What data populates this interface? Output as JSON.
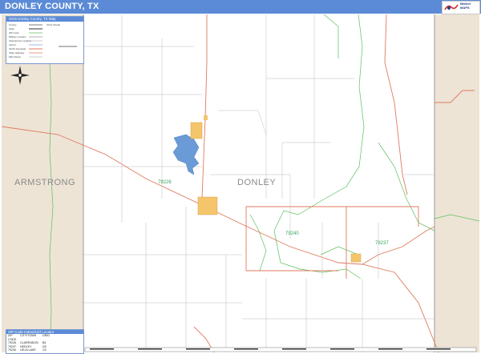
{
  "header": {
    "title": "DONLEY COUNTY, TX"
  },
  "logo": {
    "line1": "Market",
    "line2": "MAPS",
    "colors": {
      "red": "#d8262b",
      "blue": "#1f3f8a"
    }
  },
  "legend": {
    "title": "2016 Donley County, TX Map",
    "rows": [
      "County",
      "State",
      "ZIP Code",
      "Military Location",
      "Abandoned Location",
      "Airport",
      "IH/US Interstate",
      "State Highway",
      "Main Road",
      "Other Roads"
    ]
  },
  "regions": {
    "west": "ARMSTRONG",
    "center": "DONLEY"
  },
  "zips": [
    "79226",
    "79240",
    "79237"
  ],
  "zip_table": {
    "title": "ZIP Code Index/Grid Locator",
    "headers": [
      "ZIP CODE",
      "CITY/TOWN",
      "GRID"
    ],
    "rows": [
      {
        "zip": "79226",
        "city": "CLARENDON",
        "grid": "B4"
      },
      {
        "zip": "79237",
        "city": "HEDLEY",
        "grid": "D5"
      },
      {
        "zip": "79240",
        "city": "LELIA LAKE",
        "grid": "C5"
      }
    ]
  },
  "colors": {
    "header": "#5b8bd6",
    "outside_county": "#ede4d6",
    "county_border": "#9a9a9a",
    "roads": "#e07a5f",
    "zip_boundary": "#5cbf5c",
    "water": "#6b9bd6",
    "urban": "#f4c56b"
  }
}
